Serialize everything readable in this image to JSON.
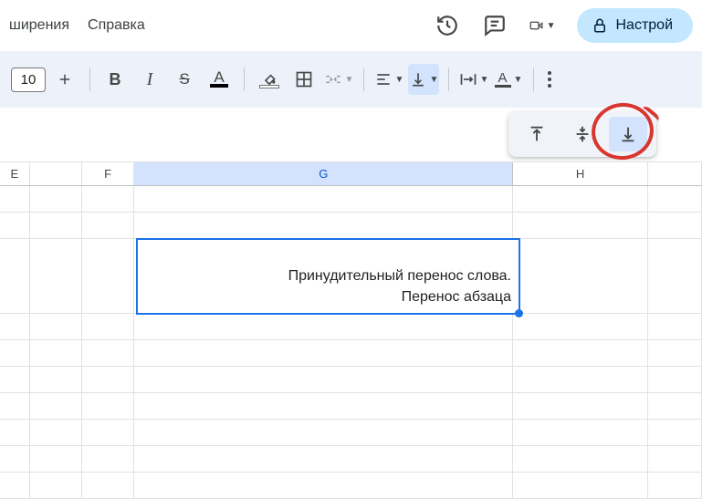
{
  "menu": {
    "extensions": "ширения",
    "help": "Справка"
  },
  "share": {
    "label": "Настрой"
  },
  "toolbar": {
    "font_size": "10"
  },
  "columns": {
    "e": "E",
    "f": "F",
    "g": "G",
    "h": "H"
  },
  "cell": {
    "line1": "Принудительный перенос слова.",
    "line2": "Перенос абзаца"
  },
  "valign_options": {
    "top": "top",
    "middle": "middle",
    "bottom": "bottom"
  }
}
